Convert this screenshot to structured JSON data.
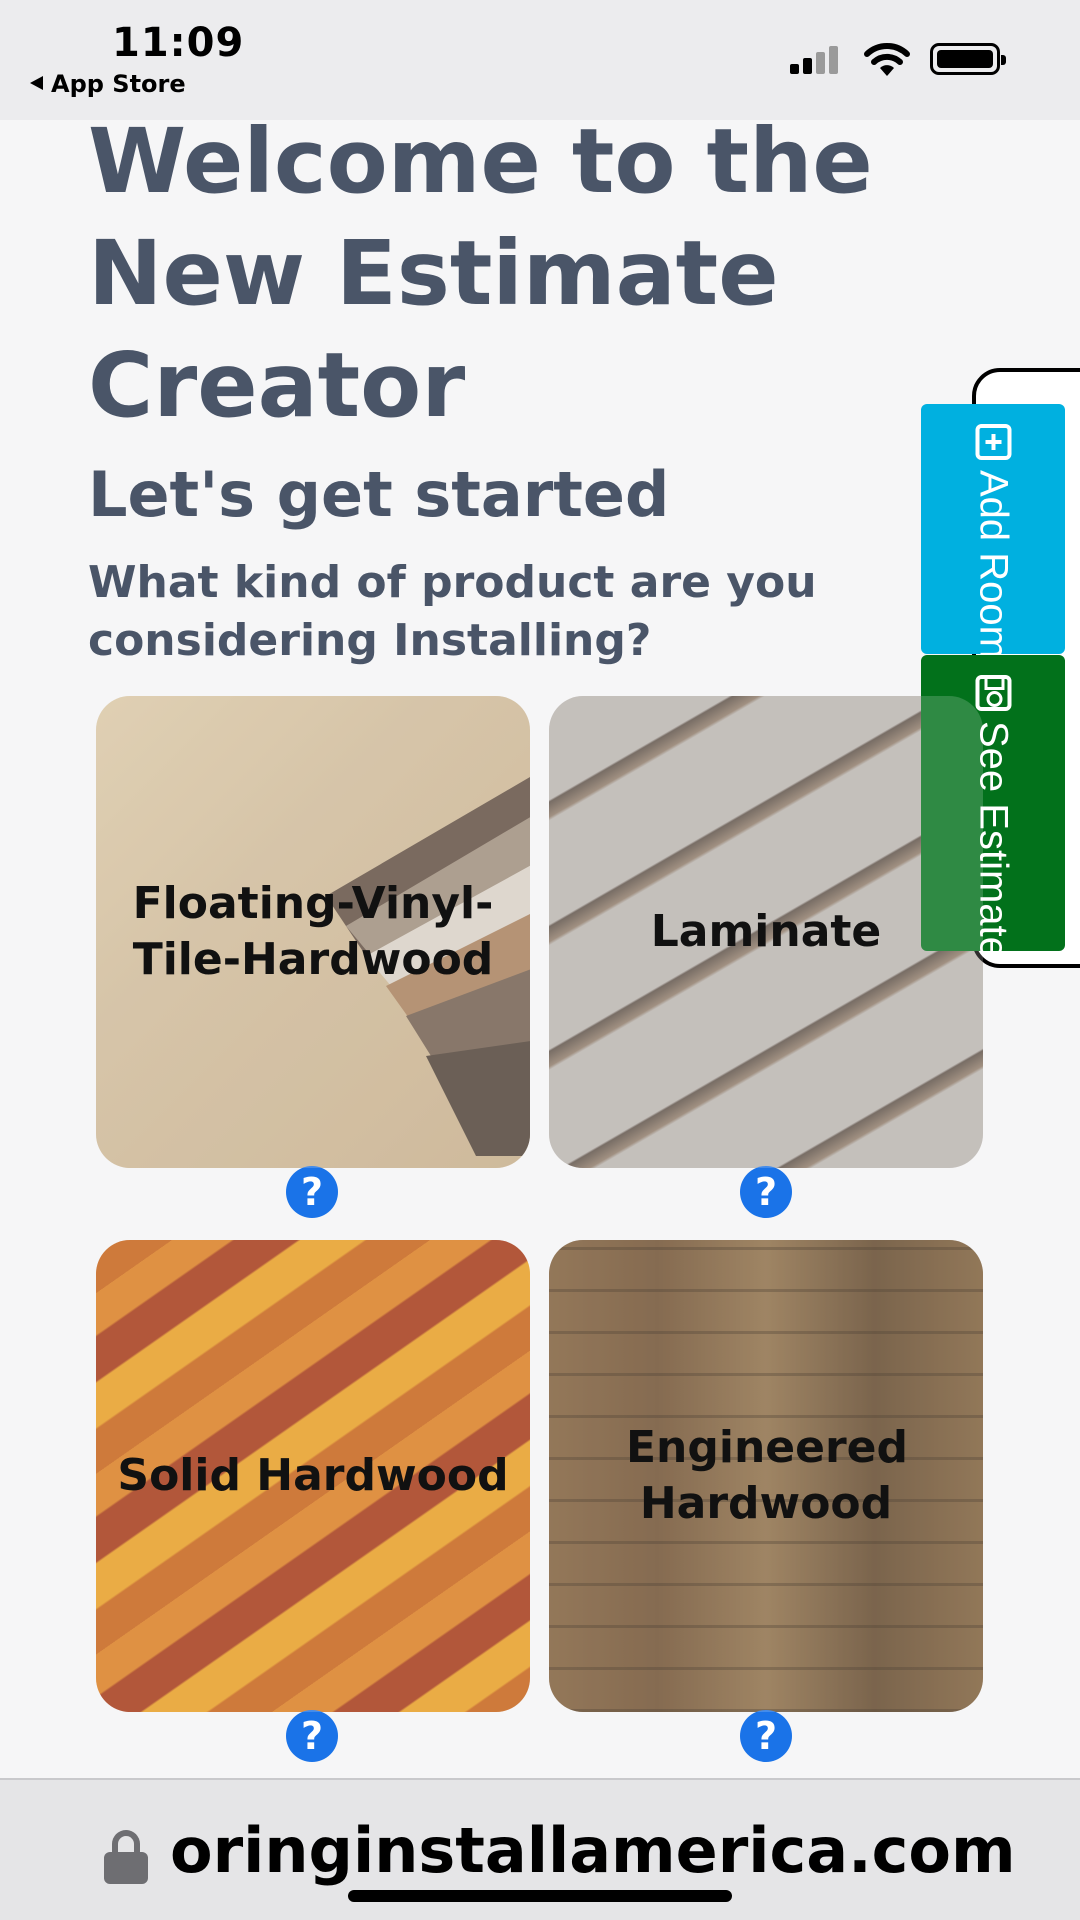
{
  "status_bar": {
    "time": "11:09",
    "back_label": "App Store",
    "icons": [
      "signal-icon",
      "wifi-icon",
      "battery-icon"
    ]
  },
  "page": {
    "title": "Welcome to the New Estimate Creator",
    "subtitle": "Let's get started",
    "question": "What kind of product are you considering Installing?"
  },
  "products": [
    {
      "label": "Floating-Vinyl-Tile-Hardwood"
    },
    {
      "label": "Laminate"
    },
    {
      "label": "Solid Hardwood"
    },
    {
      "label": "Engineered Hardwood"
    }
  ],
  "help_symbol": "?",
  "side_panel": {
    "add_room": "Add Room",
    "see_estimate": "See Estimate"
  },
  "browser": {
    "url": "oringinstallamerica.com"
  },
  "colors": {
    "heading": "#4a5568",
    "help": "#1a73e8",
    "add_room": "#00b0e0",
    "see_estimate": "#02711b"
  }
}
